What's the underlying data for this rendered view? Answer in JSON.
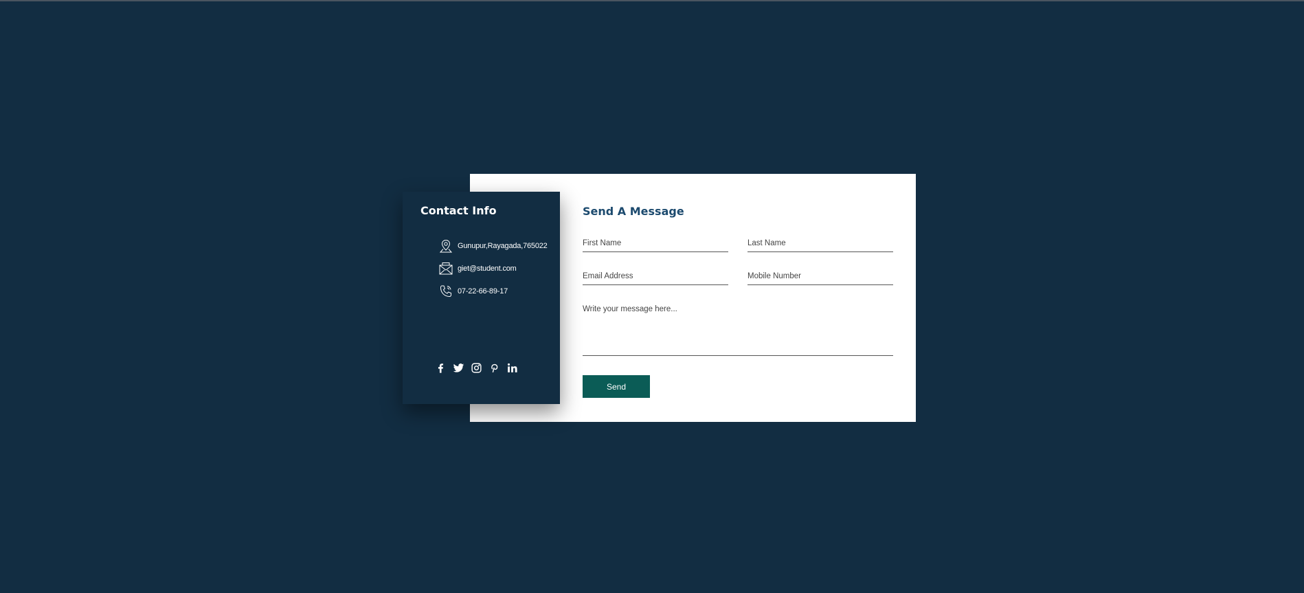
{
  "contact_info": {
    "title": "Contact Info",
    "items": [
      {
        "icon": "location-icon",
        "text": "Gunupur,Rayagada,765022"
      },
      {
        "icon": "mail-icon",
        "text": "giet@student.com"
      },
      {
        "icon": "phone-icon",
        "text": "07-22-66-89-17"
      }
    ],
    "socials": [
      "facebook-icon",
      "twitter-icon",
      "instagram-icon",
      "pinterest-icon",
      "linkedin-icon"
    ]
  },
  "form": {
    "title": "Send A Message",
    "first_name_placeholder": "First Name",
    "last_name_placeholder": "Last Name",
    "email_placeholder": "Email Address",
    "mobile_placeholder": "Mobile Number",
    "message_placeholder": "Write your message here...",
    "send_label": "Send"
  },
  "colors": {
    "background": "#122d42",
    "form_title": "#1c4a6e",
    "send_button": "#0b5c56"
  }
}
